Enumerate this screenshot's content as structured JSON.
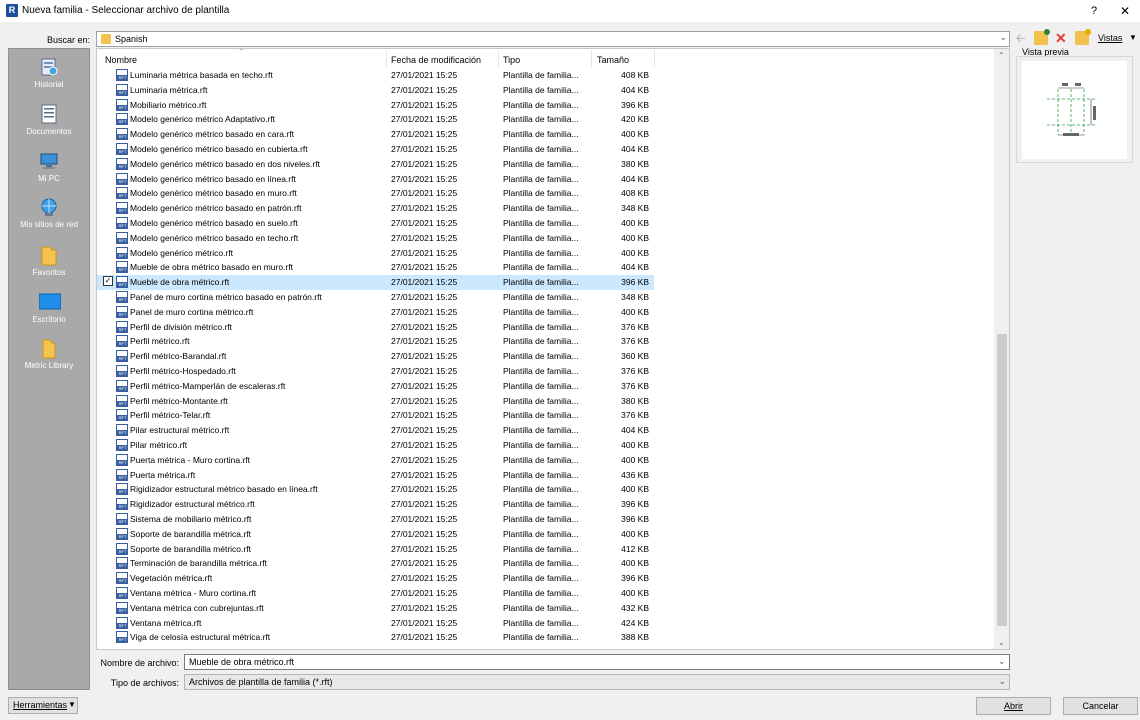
{
  "window": {
    "app_icon": "R",
    "title": "Nueva familia - Seleccionar archivo de plantilla",
    "help": "?",
    "close": "✕"
  },
  "search": {
    "label": "Buscar en:",
    "folder": "Spanish"
  },
  "toolbar": {
    "views_label": "Vistas",
    "icons": [
      "back-arrow-icon",
      "up-folder-icon",
      "delete-icon",
      "new-folder-icon"
    ]
  },
  "sidebar": {
    "items": [
      {
        "label": "Historial",
        "icon": "history-icon"
      },
      {
        "label": "Documentos",
        "icon": "documents-icon"
      },
      {
        "label": "Mi PC",
        "icon": "computer-icon"
      },
      {
        "label": "Mis sitios de red",
        "icon": "network-icon"
      },
      {
        "label": "Favoritos",
        "icon": "favorites-folder-icon"
      },
      {
        "label": "Escritorio",
        "icon": "desktop-icon"
      },
      {
        "label": "Metric Library",
        "icon": "folder-icon"
      }
    ]
  },
  "columns": {
    "name": "Nombre",
    "date": "Fecha de modificación",
    "type": "Tipo",
    "size": "Tamaño"
  },
  "files": [
    {
      "name": "Luminaria métrica basada en techo.rft",
      "date": "27/01/2021 15:25",
      "type": "Plantilla de familia...",
      "size": "408 KB"
    },
    {
      "name": "Luminaria métrica.rft",
      "date": "27/01/2021 15:25",
      "type": "Plantilla de familia...",
      "size": "404 KB"
    },
    {
      "name": "Mobiliario métrico.rft",
      "date": "27/01/2021 15:25",
      "type": "Plantilla de familia...",
      "size": "396 KB"
    },
    {
      "name": "Modelo genérico métrico Adaptativo.rft",
      "date": "27/01/2021 15:25",
      "type": "Plantilla de familia...",
      "size": "420 KB"
    },
    {
      "name": "Modelo genérico métrico basado en cara.rft",
      "date": "27/01/2021 15:25",
      "type": "Plantilla de familia...",
      "size": "400 KB"
    },
    {
      "name": "Modelo genérico métrico basado en cubierta.rft",
      "date": "27/01/2021 15:25",
      "type": "Plantilla de familia...",
      "size": "404 KB"
    },
    {
      "name": "Modelo genérico métrico basado en dos niveles.rft",
      "date": "27/01/2021 15:25",
      "type": "Plantilla de familia...",
      "size": "380 KB"
    },
    {
      "name": "Modelo genérico métrico basado en línea.rft",
      "date": "27/01/2021 15:25",
      "type": "Plantilla de familia...",
      "size": "404 KB"
    },
    {
      "name": "Modelo genérico métrico basado en muro.rft",
      "date": "27/01/2021 15:25",
      "type": "Plantilla de familia...",
      "size": "408 KB"
    },
    {
      "name": "Modelo genérico métrico basado en patrón.rft",
      "date": "27/01/2021 15:25",
      "type": "Plantilla de familia...",
      "size": "348 KB"
    },
    {
      "name": "Modelo genérico métrico basado en suelo.rft",
      "date": "27/01/2021 15:25",
      "type": "Plantilla de familia...",
      "size": "400 KB"
    },
    {
      "name": "Modelo genérico métrico basado en techo.rft",
      "date": "27/01/2021 15:25",
      "type": "Plantilla de familia...",
      "size": "400 KB"
    },
    {
      "name": "Modelo genérico métrico.rft",
      "date": "27/01/2021 15:25",
      "type": "Plantilla de familia...",
      "size": "400 KB"
    },
    {
      "name": "Mueble de obra métrico basado en muro.rft",
      "date": "27/01/2021 15:25",
      "type": "Plantilla de familia...",
      "size": "404 KB"
    },
    {
      "name": "Mueble de obra métrico.rft",
      "date": "27/01/2021 15:25",
      "type": "Plantilla de familia...",
      "size": "396 KB",
      "selected": true
    },
    {
      "name": "Panel de muro cortina métrico basado en patrón.rft",
      "date": "27/01/2021 15:25",
      "type": "Plantilla de familia...",
      "size": "348 KB"
    },
    {
      "name": "Panel de muro cortina métrico.rft",
      "date": "27/01/2021 15:25",
      "type": "Plantilla de familia...",
      "size": "400 KB"
    },
    {
      "name": "Perfil de división métrico.rft",
      "date": "27/01/2021 15:25",
      "type": "Plantilla de familia...",
      "size": "376 KB"
    },
    {
      "name": "Perfil métrico.rft",
      "date": "27/01/2021 15:25",
      "type": "Plantilla de familia...",
      "size": "376 KB"
    },
    {
      "name": "Perfil métrico-Barandal.rft",
      "date": "27/01/2021 15:25",
      "type": "Plantilla de familia...",
      "size": "360 KB"
    },
    {
      "name": "Perfil métrico-Hospedado.rft",
      "date": "27/01/2021 15:25",
      "type": "Plantilla de familia...",
      "size": "376 KB"
    },
    {
      "name": "Perfil métrico-Mamperlán de escaleras.rft",
      "date": "27/01/2021 15:25",
      "type": "Plantilla de familia...",
      "size": "376 KB"
    },
    {
      "name": "Perfil métrico-Montante.rft",
      "date": "27/01/2021 15:25",
      "type": "Plantilla de familia...",
      "size": "380 KB"
    },
    {
      "name": "Perfil métrico-Telar.rft",
      "date": "27/01/2021 15:25",
      "type": "Plantilla de familia...",
      "size": "376 KB"
    },
    {
      "name": "Pilar estructural métrico.rft",
      "date": "27/01/2021 15:25",
      "type": "Plantilla de familia...",
      "size": "404 KB"
    },
    {
      "name": "Pilar métrico.rft",
      "date": "27/01/2021 15:25",
      "type": "Plantilla de familia...",
      "size": "400 KB"
    },
    {
      "name": "Puerta métrica - Muro cortina.rft",
      "date": "27/01/2021 15:25",
      "type": "Plantilla de familia...",
      "size": "400 KB"
    },
    {
      "name": "Puerta métrica.rft",
      "date": "27/01/2021 15:25",
      "type": "Plantilla de familia...",
      "size": "436 KB"
    },
    {
      "name": "Rigidizador estructural métrico basado en línea.rft",
      "date": "27/01/2021 15:25",
      "type": "Plantilla de familia...",
      "size": "400 KB"
    },
    {
      "name": "Rigidizador estructural métrico.rft",
      "date": "27/01/2021 15:25",
      "type": "Plantilla de familia...",
      "size": "396 KB"
    },
    {
      "name": "Sistema de mobiliario métrico.rft",
      "date": "27/01/2021 15:25",
      "type": "Plantilla de familia...",
      "size": "396 KB"
    },
    {
      "name": "Soporte de barandilla métrica.rft",
      "date": "27/01/2021 15:25",
      "type": "Plantilla de familia...",
      "size": "400 KB"
    },
    {
      "name": "Soporte de barandilla métrico.rft",
      "date": "27/01/2021 15:25",
      "type": "Plantilla de familia...",
      "size": "412 KB"
    },
    {
      "name": "Terminación de barandilla métrica.rft",
      "date": "27/01/2021 15:25",
      "type": "Plantilla de familia...",
      "size": "400 KB"
    },
    {
      "name": "Vegetación métrica.rft",
      "date": "27/01/2021 15:25",
      "type": "Plantilla de familia...",
      "size": "396 KB"
    },
    {
      "name": "Ventana métrica - Muro cortina.rft",
      "date": "27/01/2021 15:25",
      "type": "Plantilla de familia...",
      "size": "400 KB"
    },
    {
      "name": "Ventana métrica con cubrejuntas.rft",
      "date": "27/01/2021 15:25",
      "type": "Plantilla de familia...",
      "size": "432 KB"
    },
    {
      "name": "Ventana métrica.rft",
      "date": "27/01/2021 15:25",
      "type": "Plantilla de familia...",
      "size": "424 KB"
    },
    {
      "name": "Viga de celosía estructural métrica.rft",
      "date": "27/01/2021 15:25",
      "type": "Plantilla de familia...",
      "size": "388 KB"
    }
  ],
  "preview": {
    "label": "Vista previa"
  },
  "fields": {
    "filename_label": "Nombre de archivo:",
    "filename_value": "Mueble de obra métrico.rft",
    "filetype_label": "Tipo de archivos:",
    "filetype_value": "Archivos de plantilla de familia  (*.rft)"
  },
  "buttons": {
    "tools": "Herramientas",
    "open": "Abrir",
    "cancel": "Cancelar"
  },
  "colors": {
    "sidebar_bg": "#a9a9a9",
    "selected_row": "#cce8ff"
  }
}
